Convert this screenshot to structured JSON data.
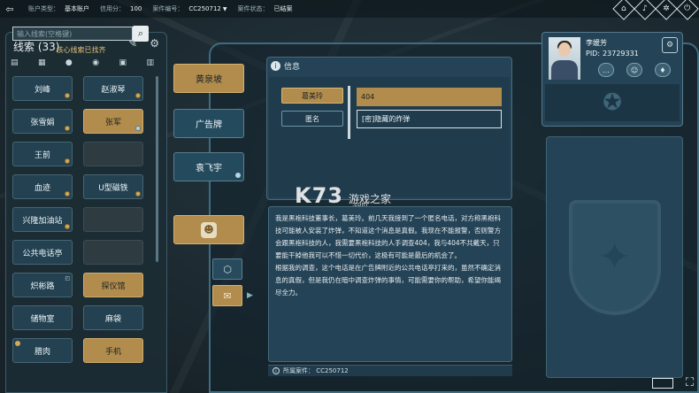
{
  "topbar": {
    "back_icon": "back-icon",
    "account_type_label": "账户类型：",
    "account_type_value": "基本账户",
    "credit_label": "信用分：",
    "credit_value": "100",
    "case_no_label": "案件编号：",
    "case_no_value": "CC250712",
    "case_status_label": "案件状态：",
    "case_status_value": "已结案",
    "icons": [
      "map-icon",
      "speaker-icon",
      "settings-icon",
      "power-icon"
    ]
  },
  "clue_panel": {
    "title": "线索 (33)",
    "search_placeholder": "输入线索(空格键)",
    "core_status": "核心线索已找齐",
    "filter_icons": [
      "document-icon",
      "person-icon",
      "location-icon",
      "box-icon",
      "trash-icon"
    ],
    "clues": [
      {
        "label": "刘峰",
        "style": "blue",
        "marker": "gold"
      },
      {
        "label": "赵淑琴",
        "style": "blue",
        "marker": "gold"
      },
      {
        "label": "张雪娟",
        "style": "blue",
        "marker": "gold"
      },
      {
        "label": "张军",
        "style": "gold",
        "marker": "blue"
      },
      {
        "label": "王前",
        "style": "blue",
        "marker": "gold"
      },
      {
        "label": "",
        "style": "empty",
        "marker": ""
      },
      {
        "label": "血迹",
        "style": "blue",
        "marker": "gold"
      },
      {
        "label": "U型磁铁",
        "style": "blue",
        "marker": "gold"
      },
      {
        "label": "兴隆加油站",
        "style": "blue",
        "marker": "gold"
      },
      {
        "label": "",
        "style": "empty",
        "marker": ""
      },
      {
        "label": "公共电话亭",
        "style": "blue",
        "marker": ""
      },
      {
        "label": "",
        "style": "empty",
        "marker": ""
      },
      {
        "label": "炽彬路",
        "style": "blue",
        "marker": "corner"
      },
      {
        "label": "探仪馆",
        "style": "gold",
        "marker": ""
      },
      {
        "label": "储物室",
        "style": "blue",
        "marker": ""
      },
      {
        "label": "麻袋",
        "style": "blue",
        "marker": ""
      },
      {
        "label": "腊肉",
        "style": "blue",
        "marker": "left"
      },
      {
        "label": "手机",
        "style": "gold",
        "marker": ""
      }
    ]
  },
  "mid_tabs": [
    {
      "label": "黄泉坡",
      "style": "gold"
    },
    {
      "label": "广告牌",
      "style": "blue"
    },
    {
      "label": "袁飞宇",
      "style": "blue"
    }
  ],
  "info": {
    "header": "信息",
    "field1_label": "葛美玲",
    "field1_value": "404",
    "field2_label": "匿名",
    "field2_value": "[密]隐藏的炸弹",
    "desc_p1": "我是黑袍科技董事长，葛美玲。前几天我接到了一个匿名电话，对方称黑袍科技可能被人安装了炸弹，不知道这个消息是真假。我现在不能报警，否则警方会跟黑袍科技的人，我需要黑袍科技的人手调查404，我与404不共戴天，只要能干掉他我可以不惜一切代价，这极有可能是最后的机会了。",
    "desc_p2": "根据我的调查，这个电话是在广告牌附近的公共电话亭打来的，虽然不确定消息的真假，但是我仍在暗中调查炸弹的事情，可能需要你的帮助，希望你能竭尽全力。",
    "footer": "所属案件：  CC250712"
  },
  "watermark": {
    "brand": "K73",
    "tagline": "游戏之家",
    "sub": ".com"
  },
  "profile": {
    "name": "李媛芳",
    "pid_label": "PID:",
    "pid_value": "23729331"
  }
}
